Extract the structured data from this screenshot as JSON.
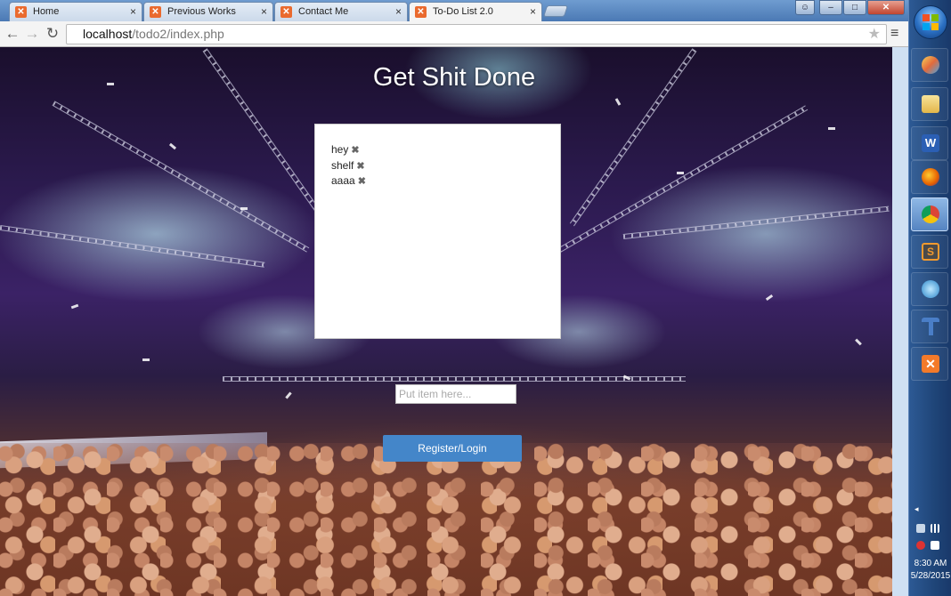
{
  "browser": {
    "tabs": [
      {
        "label": "Home",
        "active": false
      },
      {
        "label": "Previous Works",
        "active": false
      },
      {
        "label": "Contact Me",
        "active": false
      },
      {
        "label": "To-Do List 2.0",
        "active": true
      }
    ],
    "tab_close_glyph": "×",
    "address": {
      "host": "localhost",
      "path": "/todo2/index.php"
    },
    "icons": [
      "back-icon",
      "forward-icon",
      "reload-icon",
      "star-icon",
      "menu-icon",
      "user-icon",
      "minimize-icon",
      "maximize-icon",
      "close-icon"
    ]
  },
  "app": {
    "title": "Get Shit Done",
    "todos": [
      {
        "text": "hey"
      },
      {
        "text": "shelf"
      },
      {
        "text": "aaaa"
      }
    ],
    "delete_glyph": "✖",
    "input_placeholder": "Put item here...",
    "register_label": "Register/Login",
    "button_color": "#4486c9"
  },
  "taskbar": {
    "pinned": [
      "paint-icon",
      "folder-icon",
      "word-icon",
      "firefox-icon",
      "chrome-icon",
      "sublime-icon",
      "sourcetree-icon",
      "tool-icon",
      "xampp-icon"
    ],
    "active_app": "chrome-icon",
    "clock": {
      "time": "8:30 AM",
      "date": "5/28/2015"
    }
  }
}
